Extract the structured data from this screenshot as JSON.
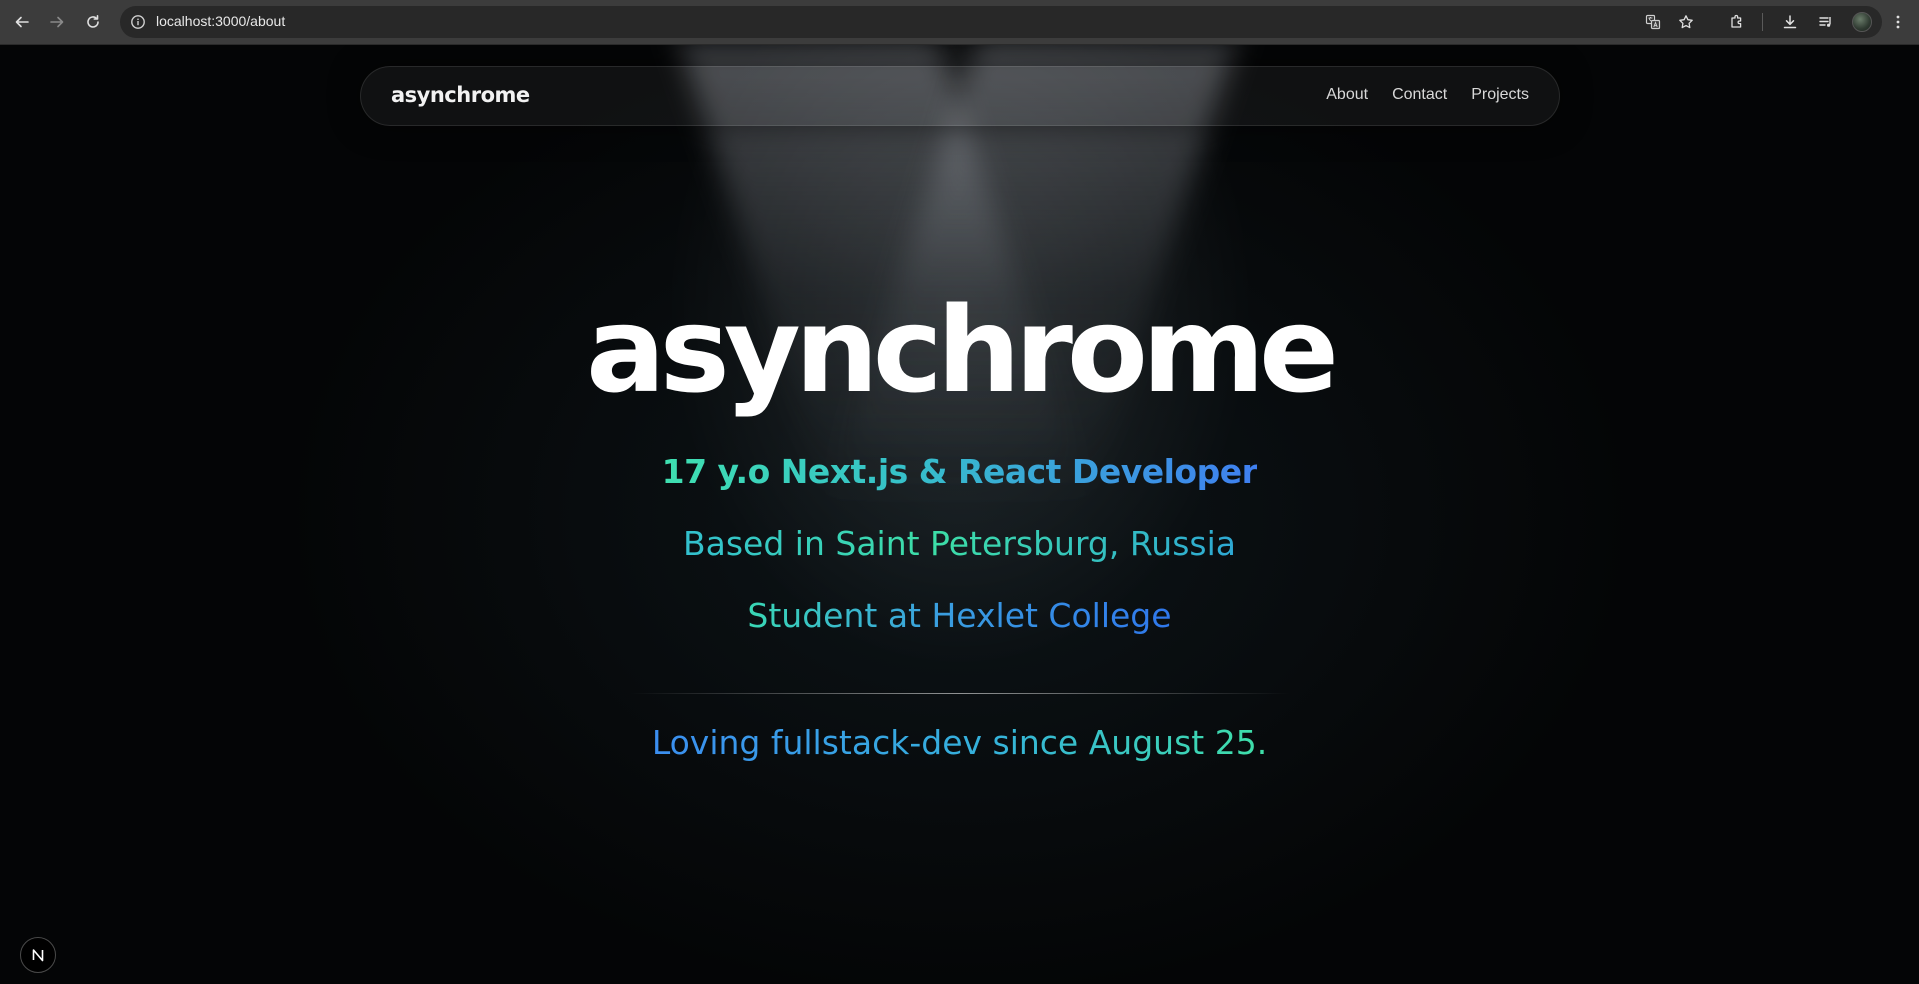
{
  "browser": {
    "url": "localhost:3000/about",
    "icons": {
      "back": "back-arrow-icon",
      "forward": "forward-arrow-icon",
      "reload": "reload-icon",
      "site_info": "info-icon",
      "translate": "translate-icon",
      "bookmark": "star-icon",
      "extensions": "puzzle-icon",
      "downloads": "download-icon",
      "media": "media-queue-icon",
      "profile": "avatar",
      "menu": "kebab-menu-icon"
    }
  },
  "site": {
    "logo": "asynchrome",
    "nav": [
      "About",
      "Contact",
      "Projects"
    ]
  },
  "hero": {
    "title": "asynchrome",
    "line1": "17 y.o Next.js & React Developer",
    "line2": "Based in Saint Petersburg, Russia",
    "line3": "Student at Hexlet College",
    "line4": "Loving fullstack-dev since August 25."
  },
  "dev_badge": {
    "letter": "N"
  },
  "colors": {
    "background": "#040506",
    "gradient_teal": "#3fe0b0",
    "gradient_cyan": "#36c1c9",
    "gradient_blue": "#3f7ff0",
    "text_white": "#ffffff"
  }
}
